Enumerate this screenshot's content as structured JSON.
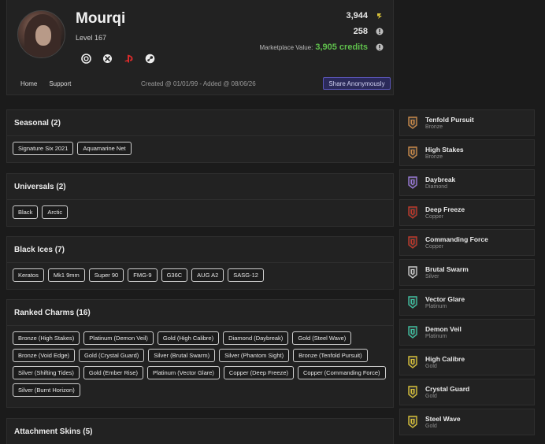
{
  "profile": {
    "username": "Mourqi",
    "level": "Level 167",
    "stat_coins": "3,944",
    "stat_items": "258",
    "marketplace_label": "Marketplace Value:",
    "marketplace_value": "3,905 credits",
    "platform_icons": [
      "ubisoft-icon",
      "xbox-icon",
      "playstation-icon",
      "steam-icon"
    ],
    "coins_color": "#d8c13a",
    "credits_color": "#5fbf4c"
  },
  "nav": {
    "home": "Home",
    "support": "Support"
  },
  "created_text": "Created @ 01/01/99 - Added @ 08/06/26",
  "share_label": "Share Anonymously",
  "sections": {
    "seasonals": {
      "title": "Seasonal (2)",
      "items": [
        "Signature Six 2021",
        "Aquamarine Net"
      ]
    },
    "universals": {
      "title": "Universals (2)",
      "items": [
        "Black",
        "Arctic"
      ]
    },
    "black_ices": {
      "title": "Black Ices (7)",
      "items": [
        "Keratos",
        "Mk1 9mm",
        "Super 90",
        "FMG-9",
        "G36C",
        "AUG A2",
        "SASG-12"
      ]
    },
    "ranked_charms": {
      "title": "Ranked Charms (16)",
      "items": [
        "Bronze (High Stakes)",
        "Platinum (Demon Veil)",
        "Gold (High Calibre)",
        "Diamond (Daybreak)",
        "Gold (Steel Wave)",
        "Bronze (Void Edge)",
        "Gold (Crystal Guard)",
        "Silver (Brutal Swarm)",
        "Silver (Phantom Sight)",
        "Bronze (Tenfold Pursuit)",
        "Silver (Shifting Tides)",
        "Gold (Ember Rise)",
        "Platinum (Vector Glare)",
        "Copper (Deep Freeze)",
        "Copper (Commanding Force)",
        "Silver (Burnt Horizon)"
      ]
    },
    "attachment_skins": {
      "title": "Attachment Skins (5)"
    }
  },
  "charms": [
    {
      "name": "Tenfold Pursuit",
      "tier": "Bronze",
      "color": "#c98a4a"
    },
    {
      "name": "High Stakes",
      "tier": "Bronze",
      "color": "#c98a4a"
    },
    {
      "name": "Daybreak",
      "tier": "Diamond",
      "color": "#9a7ad8"
    },
    {
      "name": "Deep Freeze",
      "tier": "Copper",
      "color": "#c0392b"
    },
    {
      "name": "Commanding Force",
      "tier": "Copper",
      "color": "#c0392b"
    },
    {
      "name": "Brutal Swarm",
      "tier": "Silver",
      "color": "#c8c8c8"
    },
    {
      "name": "Vector Glare",
      "tier": "Platinum",
      "color": "#3fbfa0"
    },
    {
      "name": "Demon Veil",
      "tier": "Platinum",
      "color": "#3fbfa0"
    },
    {
      "name": "High Calibre",
      "tier": "Gold",
      "color": "#d8c13a"
    },
    {
      "name": "Crystal Guard",
      "tier": "Gold",
      "color": "#d8c13a"
    },
    {
      "name": "Steel Wave",
      "tier": "Gold",
      "color": "#d8c13a"
    }
  ]
}
